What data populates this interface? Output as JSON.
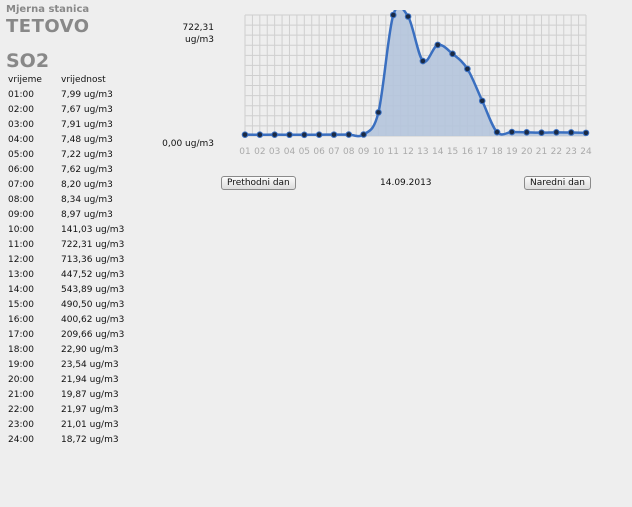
{
  "station": {
    "label": "Mjerna stanica",
    "name": "TETOVO"
  },
  "pollutant": "SO2",
  "table": {
    "headers": {
      "time": "vrijeme",
      "value": "vrijednost"
    },
    "rows": [
      {
        "time": "01:00",
        "value": "7,99 ug/m3"
      },
      {
        "time": "02:00",
        "value": "7,67 ug/m3"
      },
      {
        "time": "03:00",
        "value": "7,91 ug/m3"
      },
      {
        "time": "04:00",
        "value": "7,48 ug/m3"
      },
      {
        "time": "05:00",
        "value": "7,22 ug/m3"
      },
      {
        "time": "06:00",
        "value": "7,62 ug/m3"
      },
      {
        "time": "07:00",
        "value": "8,20 ug/m3"
      },
      {
        "time": "08:00",
        "value": "8,34 ug/m3"
      },
      {
        "time": "09:00",
        "value": "8,97 ug/m3"
      },
      {
        "time": "10:00",
        "value": "141,03 ug/m3"
      },
      {
        "time": "11:00",
        "value": "722,31 ug/m3"
      },
      {
        "time": "12:00",
        "value": "713,36 ug/m3"
      },
      {
        "time": "13:00",
        "value": "447,52 ug/m3"
      },
      {
        "time": "14:00",
        "value": "543,89 ug/m3"
      },
      {
        "time": "15:00",
        "value": "490,50 ug/m3"
      },
      {
        "time": "16:00",
        "value": "400,62 ug/m3"
      },
      {
        "time": "17:00",
        "value": "209,66 ug/m3"
      },
      {
        "time": "18:00",
        "value": "22,90 ug/m3"
      },
      {
        "time": "19:00",
        "value": "23,54 ug/m3"
      },
      {
        "time": "20:00",
        "value": "21,94 ug/m3"
      },
      {
        "time": "21:00",
        "value": "19,87 ug/m3"
      },
      {
        "time": "22:00",
        "value": "21,97 ug/m3"
      },
      {
        "time": "23:00",
        "value": "21,01 ug/m3"
      },
      {
        "time": "24:00",
        "value": "18,72 ug/m3"
      }
    ]
  },
  "chart_labels": {
    "ymax_value": "722,31",
    "ymax_unit": "ug/m3",
    "ymin": "0,00 ug/m3"
  },
  "nav": {
    "prev_label": "Prethodni dan",
    "date": "14.09.2013",
    "next_label": "Naredni dan"
  },
  "colors": {
    "line": "#3a6fc0",
    "fill": "#b4c4dc",
    "point": "#1a2a44",
    "grid": "#cfcfcf",
    "tick": "#aaaaaa",
    "heading": "#888888"
  },
  "chart_data": {
    "type": "area",
    "categories": [
      "01",
      "02",
      "03",
      "04",
      "05",
      "06",
      "07",
      "08",
      "09",
      "10",
      "11",
      "12",
      "13",
      "14",
      "15",
      "16",
      "17",
      "18",
      "19",
      "20",
      "21",
      "22",
      "23",
      "24"
    ],
    "values": [
      7.99,
      7.67,
      7.91,
      7.48,
      7.22,
      7.62,
      8.2,
      8.34,
      8.97,
      141.03,
      722.31,
      713.36,
      447.52,
      543.89,
      490.5,
      400.62,
      209.66,
      22.9,
      23.54,
      21.94,
      19.87,
      21.97,
      21.01,
      18.72
    ],
    "ylim": [
      0,
      722.31
    ],
    "grid": true,
    "unit": "ug/m3"
  }
}
